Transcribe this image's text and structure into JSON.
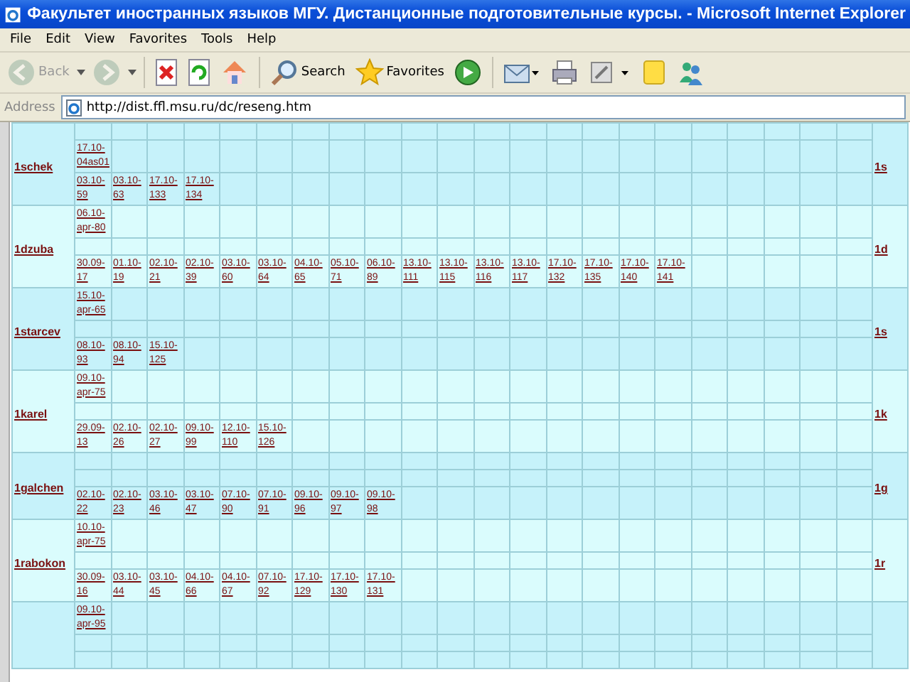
{
  "window": {
    "title": "Факультет иностранных языков МГУ. Дистанционные подготовительные курсы. - Microsoft Internet Explorer"
  },
  "menu": [
    "File",
    "Edit",
    "View",
    "Favorites",
    "Tools",
    "Help"
  ],
  "toolbar": [
    {
      "kind": "back",
      "label": "Back",
      "disabled": true
    },
    {
      "kind": "forward",
      "disabled": true
    },
    {
      "kind": "stop"
    },
    {
      "kind": "refresh"
    },
    {
      "kind": "home"
    },
    {
      "kind": "search",
      "label": "Search"
    },
    {
      "kind": "favorites",
      "label": "Favorites"
    },
    {
      "kind": "media"
    },
    {
      "kind": "mail"
    },
    {
      "kind": "print"
    },
    {
      "kind": "edit"
    },
    {
      "kind": "note"
    },
    {
      "kind": "messenger"
    }
  ],
  "address": {
    "label": "Address",
    "value": "http://dist.ffl.msu.ru/dc/reseng.htm"
  },
  "groups": [
    {
      "name": "1schek",
      "right_name": "1s",
      "color": "#c6f2fa",
      "rows": [
        [],
        [
          "17.10-04as01"
        ],
        [
          "03.10-59",
          "03.10-63",
          "17.10-133",
          "17.10-134"
        ]
      ]
    },
    {
      "name": "1dzuba",
      "right_name": "1d",
      "color": "#dafcfd",
      "rows": [
        [
          "06.10-apr-80"
        ],
        [],
        [
          "30.09-17",
          "01.10-19",
          "02.10-21",
          "02.10-39",
          "03.10-60",
          "03.10-64",
          "04.10-65",
          "05.10-71",
          "06.10-89",
          "13.10-111",
          "13.10-115",
          "13.10-116",
          "13.10-117",
          "17.10-132",
          "17.10-135",
          "17.10-140",
          "17.10-141"
        ]
      ]
    },
    {
      "name": "1starcev",
      "right_name": "1s",
      "color": "#c6f2fa",
      "rows": [
        [
          "15.10-apr-65"
        ],
        [],
        [
          "08.10-93",
          "08.10-94",
          "15.10-125"
        ]
      ]
    },
    {
      "name": "1karel",
      "right_name": "1k",
      "color": "#dafcfd",
      "rows": [
        [
          "09.10-apr-75"
        ],
        [],
        [
          "29.09-13",
          "02.10-26",
          "02.10-27",
          "09.10-99",
          "12.10-110",
          "15.10-126"
        ]
      ]
    },
    {
      "name": "1galchen",
      "right_name": "1g",
      "color": "#c6f2fa",
      "rows": [
        [],
        [],
        [
          "02.10-22",
          "02.10-23",
          "03.10-46",
          "03.10-47",
          "07.10-90",
          "07.10-91",
          "09.10-96",
          "09.10-97",
          "09.10-98"
        ]
      ]
    },
    {
      "name": "1rabokon",
      "right_name": "1r",
      "color": "#dafcfd",
      "rows": [
        [
          "10.10-apr-75"
        ],
        [],
        [
          "30.09-16",
          "03.10-44",
          "03.10-45",
          "04.10-66",
          "04.10-67",
          "07.10-92",
          "17.10-129",
          "17.10-130",
          "17.10-131"
        ]
      ]
    },
    {
      "color": "#c6f2fa",
      "rows": [
        [
          "09.10-apr-95"
        ],
        [],
        []
      ]
    }
  ]
}
